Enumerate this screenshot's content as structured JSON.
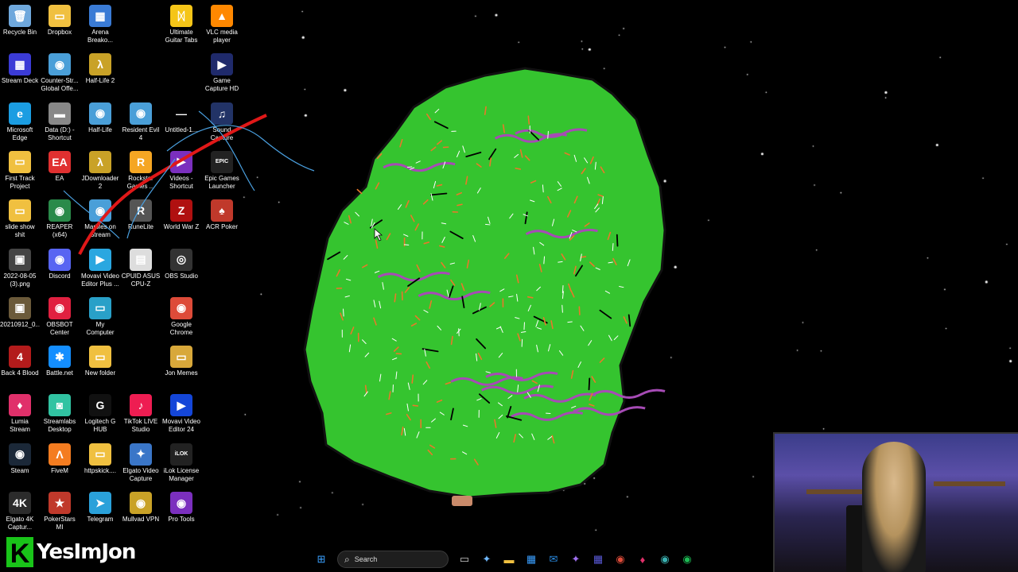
{
  "desktop": {
    "icons": [
      {
        "label": "Recycle Bin",
        "glyph": "🗑",
        "color": "#6fa8dc"
      },
      {
        "label": "Dropbox",
        "glyph": "▭",
        "color": "#f0c040"
      },
      {
        "label": "Arena\nBreako...",
        "glyph": "▦",
        "color": "#3a7bd5"
      },
      {
        "label": "Ultimate\nGuitar Tabs",
        "glyph": "ᛞ",
        "color": "#f5c518"
      },
      {
        "label": "VLC media\nplayer",
        "glyph": "▲",
        "color": "#ff8800"
      },
      {
        "label": "Stream Deck",
        "glyph": "▦",
        "color": "#3b3bd6"
      },
      {
        "label": "Counter-Str...\nGlobal Offe...",
        "glyph": "◉",
        "color": "#4a9fd8"
      },
      {
        "label": "Half-Life 2",
        "glyph": "λ",
        "color": "#c9a227"
      },
      {
        "label": "Game\nCapture HD",
        "glyph": "▶",
        "color": "#1f2a6b"
      },
      {
        "label": "Microsoft\nEdge",
        "glyph": "e",
        "color": "#1b9de2"
      },
      {
        "label": "Data (D:) -\nShortcut",
        "glyph": "▬",
        "color": "#888"
      },
      {
        "label": "Half-Life",
        "glyph": "◉",
        "color": "#4a9fd8"
      },
      {
        "label": "Resident Evil\n4",
        "glyph": "◉",
        "color": "#4a9fd8"
      },
      {
        "label": "Untitled-1...",
        "glyph": "—",
        "color": "#000"
      },
      {
        "label": "Sound\nCapture",
        "glyph": "♫",
        "color": "#223366"
      },
      {
        "label": "First Track\nProject",
        "glyph": "▭",
        "color": "#f0c040"
      },
      {
        "label": "EA",
        "glyph": "EA",
        "color": "#e03030"
      },
      {
        "label": "JDownloader\n2",
        "glyph": "λ",
        "color": "#c9a227"
      },
      {
        "label": "Rockstar\nGames ...",
        "glyph": "R",
        "color": "#f5a623"
      },
      {
        "label": "Videos -\nShortcut",
        "glyph": "▶",
        "color": "#7b2fbe"
      },
      {
        "label": "Epic Games\nLauncher",
        "glyph": "EPIC",
        "color": "#222"
      },
      {
        "label": "slide show\nshit",
        "glyph": "▭",
        "color": "#f0c040"
      },
      {
        "label": "REAPER (x64)",
        "glyph": "◉",
        "color": "#2a8a4a"
      },
      {
        "label": "Marbles on\nStream",
        "glyph": "◉",
        "color": "#4a9fd8"
      },
      {
        "label": "RuneLite",
        "glyph": "R",
        "color": "#555"
      },
      {
        "label": "World War Z",
        "glyph": "Z",
        "color": "#b01010"
      },
      {
        "label": "ACR Poker",
        "glyph": "♠",
        "color": "#c0392b"
      },
      {
        "label": "2022-08-05\n(3).png",
        "glyph": "▣",
        "color": "#444"
      },
      {
        "label": "Discord",
        "glyph": "◉",
        "color": "#5865f2"
      },
      {
        "label": "Movavi Video\nEditor Plus ...",
        "glyph": "▶",
        "color": "#2aa7e0"
      },
      {
        "label": "CPUID ASUS\nCPU-Z",
        "glyph": "▤",
        "color": "#ddd"
      },
      {
        "label": "OBS Studio",
        "glyph": "◎",
        "color": "#333"
      },
      {
        "label": "20210912_0...",
        "glyph": "▣",
        "color": "#6b5a3a"
      },
      {
        "label": "OBSBOT\nCenter",
        "glyph": "◉",
        "color": "#e02040"
      },
      {
        "label": "My\nComputer",
        "glyph": "▭",
        "color": "#29a0c8"
      },
      {
        "label": "Google\nChrome",
        "glyph": "◉",
        "color": "#dd4b39"
      },
      {
        "label": "Back 4 Blood",
        "glyph": "4",
        "color": "#b31b1b"
      },
      {
        "label": "Battle.net",
        "glyph": "✱",
        "color": "#148eff"
      },
      {
        "label": "New folder",
        "glyph": "▭",
        "color": "#f0c040"
      },
      {
        "label": "Jon Memes",
        "glyph": "▭",
        "color": "#d8a83a"
      },
      {
        "label": "Lumia\nStream",
        "glyph": "♦",
        "color": "#e0306a"
      },
      {
        "label": "Streamlabs\nDesktop",
        "glyph": "◙",
        "color": "#31c3a2"
      },
      {
        "label": "Logitech G\nHUB",
        "glyph": "G",
        "color": "#111"
      },
      {
        "label": "TikTok LIVE\nStudio",
        "glyph": "♪",
        "color": "#ee1d52"
      },
      {
        "label": "Movavi Video\nEditor 24",
        "glyph": "▶",
        "color": "#1446d8"
      },
      {
        "label": "Steam",
        "glyph": "◉",
        "color": "#1b2838"
      },
      {
        "label": "FiveM",
        "glyph": "Λ",
        "color": "#f47c20"
      },
      {
        "label": "httpskick....",
        "glyph": "▭",
        "color": "#f0c040"
      },
      {
        "label": "Elgato Video\nCapture",
        "glyph": "✦",
        "color": "#3a76c8"
      },
      {
        "label": "iLok License\nManager",
        "glyph": "iLOK",
        "color": "#222"
      },
      {
        "label": "Elgato 4K\nCaptur...",
        "glyph": "4K",
        "color": "#2b2b2b"
      },
      {
        "label": "PokerStars MI",
        "glyph": "★",
        "color": "#c0392b"
      },
      {
        "label": "Telegram",
        "glyph": "➤",
        "color": "#2aa1da"
      },
      {
        "label": "Mullvad VPN",
        "glyph": "◉",
        "color": "#c9a227"
      },
      {
        "label": "Pro Tools",
        "glyph": "◉",
        "color": "#7b2fbe"
      }
    ]
  },
  "taskbar": {
    "search_label": "Search",
    "icons": [
      {
        "name": "start-icon",
        "glyph": "⊞",
        "color": "#3aa0ff"
      },
      {
        "name": "task-view-icon",
        "glyph": "▭",
        "color": "#ccc"
      },
      {
        "name": "copilot-icon",
        "glyph": "✦",
        "color": "#6fb8ff"
      },
      {
        "name": "file-explorer-icon",
        "glyph": "▬",
        "color": "#f0c040"
      },
      {
        "name": "store-icon",
        "glyph": "▦",
        "color": "#3a9fff"
      },
      {
        "name": "mail-icon",
        "glyph": "✉",
        "color": "#2a8ae0"
      },
      {
        "name": "copilot-app-icon",
        "glyph": "✦",
        "color": "#a070f0"
      },
      {
        "name": "stream-deck-icon",
        "glyph": "▦",
        "color": "#5a5ad8"
      },
      {
        "name": "chrome-icon",
        "glyph": "◉",
        "color": "#dd4b39"
      },
      {
        "name": "lumia-icon",
        "glyph": "♦",
        "color": "#e0306a"
      },
      {
        "name": "app-icon",
        "glyph": "◉",
        "color": "#3ab0b0"
      },
      {
        "name": "spotify-icon",
        "glyph": "◉",
        "color": "#1db954"
      }
    ]
  },
  "overlay": {
    "logo_letter": "K",
    "channel_name": "YesImJon"
  },
  "colors": {
    "blob": "#35c42f",
    "purple": "#a64bb5",
    "orange": "#e9782a"
  }
}
